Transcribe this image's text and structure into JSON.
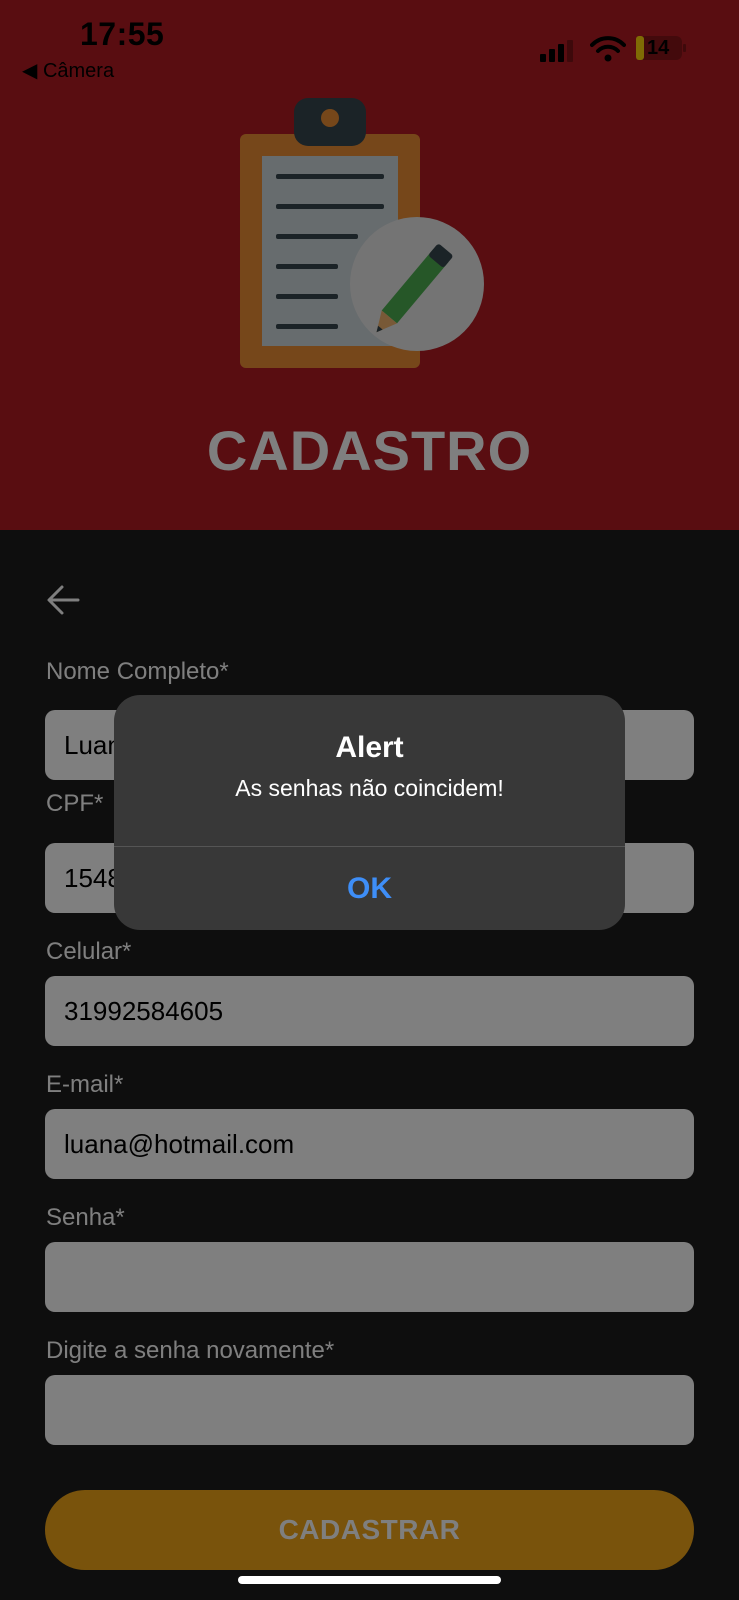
{
  "status_bar": {
    "time": "17:55",
    "back_app": "◀ Câmera",
    "battery": "14"
  },
  "header": {
    "title": "CADASTRO"
  },
  "form": {
    "fields": [
      {
        "label": "Nome Completo*",
        "value": "Luana"
      },
      {
        "label": "CPF*",
        "value": "15486925874"
      },
      {
        "label": "Celular*",
        "value": "31992584605"
      },
      {
        "label": "E-mail*",
        "value": "luana@hotmail.com"
      },
      {
        "label": "Senha*",
        "value": ""
      },
      {
        "label": "Digite a senha novamente*",
        "value": ""
      }
    ],
    "submit_label": "CADASTRAR"
  },
  "alert": {
    "title": "Alert",
    "message": "As senhas não coincidem!",
    "ok_label": "OK"
  },
  "colors": {
    "header_bg": "#b31b22",
    "page_bg": "#1c1c1c",
    "button_bg": "#f2a619",
    "alert_bg": "#383838",
    "alert_ok": "#3e8ef7"
  },
  "icons": [
    "signal-icon",
    "wifi-icon",
    "battery-icon",
    "clipboard-icon",
    "pencil-icon",
    "back-arrow-icon"
  ]
}
